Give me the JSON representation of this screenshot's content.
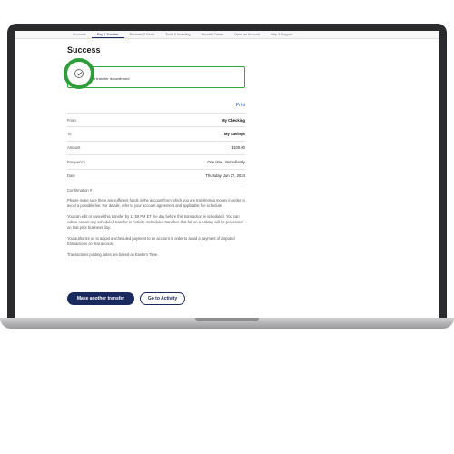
{
  "nav": {
    "items": [
      "Accounts",
      "Pay & Transfer",
      "Rewards & Deals",
      "Tools & Investing",
      "Security Center",
      "Open an Account",
      "Help & Support"
    ],
    "active_index": 1
  },
  "page": {
    "title": "Success",
    "confirmation": "Your transfer is confirmed",
    "print_label": "Print"
  },
  "details": [
    {
      "label": "From",
      "value": "My Checking",
      "bold": true
    },
    {
      "label": "To",
      "value": "My Savings",
      "bold": true
    },
    {
      "label": "Amount",
      "value": "$100.00",
      "bold": false
    },
    {
      "label": "Frequency",
      "value": "One time, immediately",
      "bold": false
    },
    {
      "label": "Date",
      "value": "Thursday, Jun 27, 2024",
      "bold": false
    },
    {
      "label": "Confirmation #",
      "value": "",
      "bold": false
    }
  ],
  "paragraphs": [
    "Please make sure there are sufficient funds in the account from which you are transferring money in order to avoid a possible fee. For details, refer to your account agreement and applicable fee schedule.",
    "You can edit or cancel this transfer by 11:59 PM ET the day before this transaction is scheduled. You can edit or cancel any scheduled transfer in Activity. Scheduled transfers that fall on a holiday will be processed on that prior business day.",
    "You authorize us to adjust a scheduled payment to an account in order to avoid a payment of disputed transactions on that account.",
    "Transactions posting dates are based on Eastern Time."
  ],
  "buttons": {
    "primary": "Make another transfer",
    "secondary": "Go to Activity"
  },
  "colors": {
    "brand": "#1b2a5e",
    "success": "#2e9e3a",
    "link": "#1b5bb8"
  }
}
